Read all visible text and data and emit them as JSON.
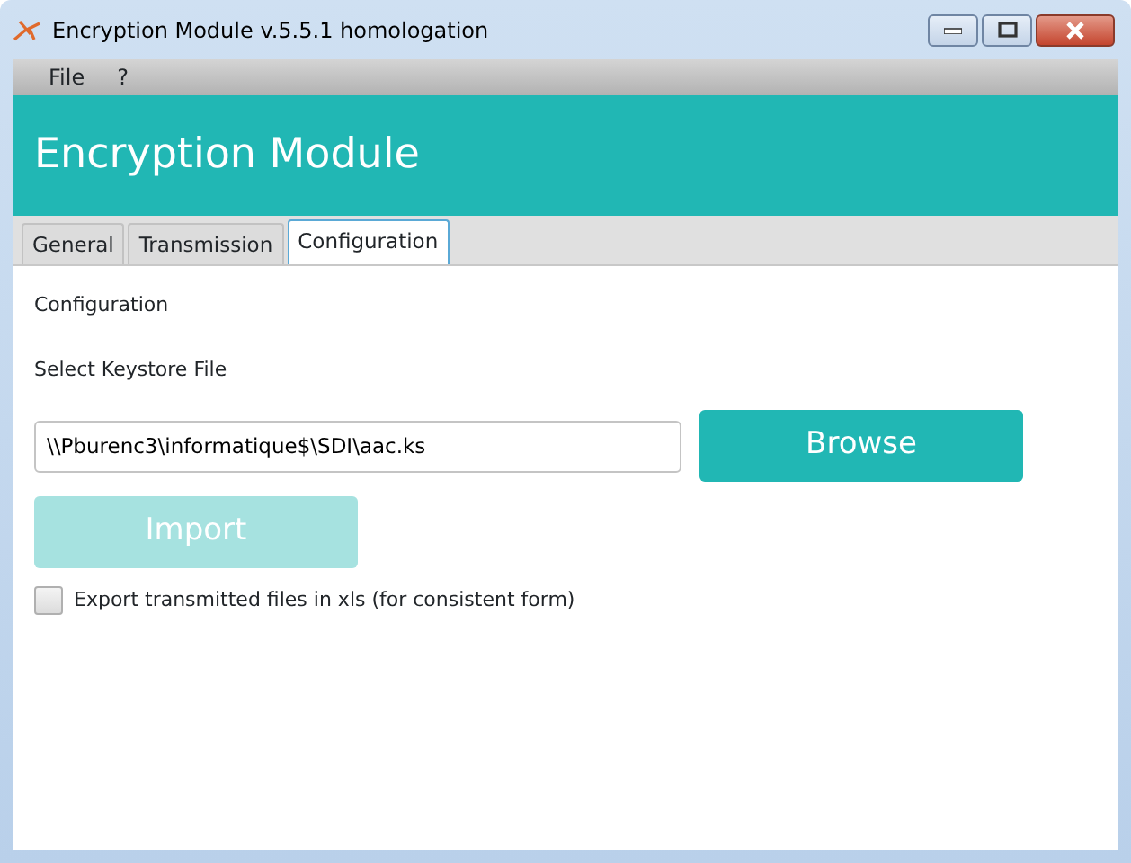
{
  "window": {
    "title": "Encryption Module v.5.5.1 homologation"
  },
  "menu": [
    "File",
    "?"
  ],
  "header": {
    "title": "Encryption Module"
  },
  "tabs": [
    {
      "label": "General",
      "selected": false
    },
    {
      "label": "Transmission",
      "selected": false
    },
    {
      "label": "Configuration",
      "selected": true
    }
  ],
  "section_title": "Configuration",
  "keystore": {
    "label": "Select Keystore File",
    "value": "\\\\Pburenc3\\informatique$\\SDI\\aac.ks"
  },
  "buttons": [
    {
      "label": "Browse",
      "disabled": false
    },
    {
      "label": "Import",
      "disabled": true
    }
  ],
  "export_checkbox": {
    "label": "Export transmitted files in xls (for consistent form)",
    "checked": false
  }
}
